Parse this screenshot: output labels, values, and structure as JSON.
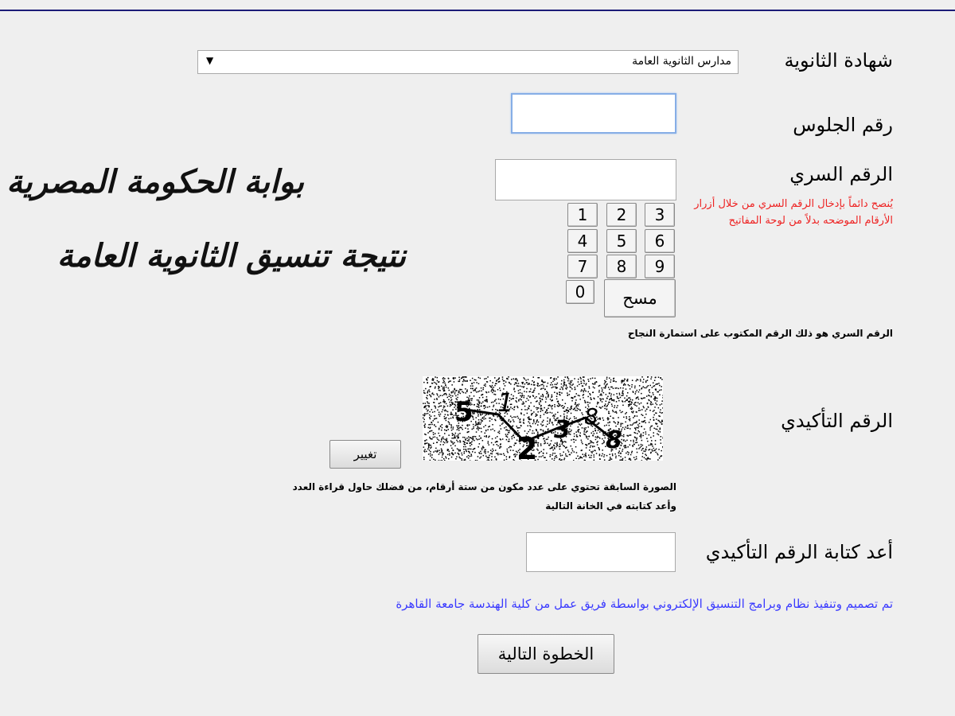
{
  "form": {
    "certificate_label": "شهادة الثانوية",
    "certificate_value": "مدارس الثانوية العامة",
    "seat_number_label": "رقم الجلوس",
    "seat_number_value": "",
    "secret_number_label": "الرقم السري",
    "secret_number_value": "",
    "secret_advice": "يُنصح دائماً بإدخال الرقم السري من خلال أزرار الأرقام الموضحه بدلاً من لوحة المفاتيح",
    "keypad": {
      "keys": [
        "1",
        "2",
        "3",
        "4",
        "5",
        "6",
        "7",
        "8",
        "9",
        "0"
      ],
      "clear_label": "مسح"
    },
    "secret_number_note": "الرقم السري هو ذلك الرقم المكتوب على استمارة النجاح",
    "captcha_label": "الرقم التأكيدي",
    "captcha_digits": [
      "5",
      "1",
      "2",
      "3",
      "8",
      "8"
    ],
    "change_button_label": "تغيير",
    "captcha_note_line1": "الصورة السابقة تحتوي على عدد مكون من ستة أرقام، من فضلك حاول قراءة العدد",
    "captcha_note_line2": "وأعد كتابته في الخانة التالية",
    "retype_label": "أعد كتابة الرقم التأكيدي",
    "retype_value": "",
    "credits": "تم تصميم وتنفيذ نظام وبرامج التنسيق الإلكتروني بواسطة فريق عمل من كلية الهندسة جامعة القاهرة",
    "next_button_label": "الخطوة التالية"
  },
  "overlay": {
    "line1": "بوابة الحكومة المصرية",
    "line2": "نتيجة تنسيق الثانوية العامة"
  },
  "colors": {
    "background": "#efefef",
    "top_line": "#1c1c78",
    "note_red": "#ee2222",
    "link_blue": "#3a3aff",
    "focus_border": "#86aee6"
  }
}
